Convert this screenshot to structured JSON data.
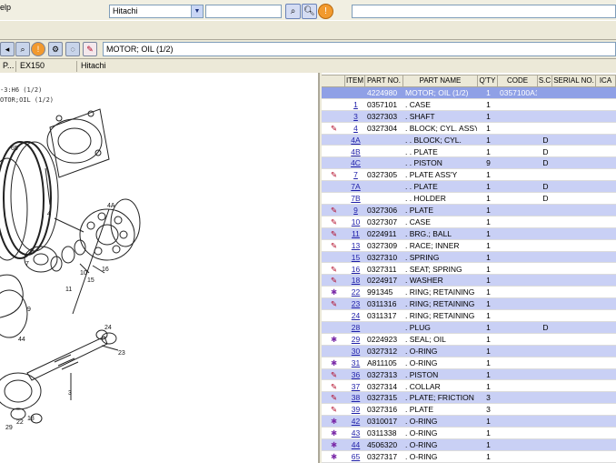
{
  "menubar": {
    "help_label": "elp"
  },
  "toolbar": {
    "manufacturer_value": "Hitachi",
    "search_value": ""
  },
  "title_box": "MOTOR; OIL (1/2)",
  "infobar": {
    "col1": "P...",
    "col2": "EX150",
    "col3": "Hitachi"
  },
  "drawing": {
    "label1": "-3:H6 (1/2)",
    "label2": "OTOR;OIL (1/2)",
    "callouts": [
      "65",
      "4",
      "3",
      "7",
      "4",
      "4A",
      "9",
      "10",
      "15",
      "16",
      "11",
      "13",
      "12",
      "8",
      "5",
      "44",
      "3",
      "24",
      "23",
      "22",
      "21",
      "29",
      "11",
      "18",
      "1"
    ]
  },
  "table": {
    "columns": [
      "ITEM",
      "PART NO.",
      "PART NAME",
      "Q'TY",
      "CODE",
      "S.C",
      "SERIAL NO.",
      "ICA"
    ],
    "rows": [
      {
        "icon": "",
        "item": "",
        "part": "4224980",
        "name": "MOTOR; OIL (1/2)",
        "qty": "1",
        "code": "0357100A1",
        "sc": "",
        "sel": true
      },
      {
        "icon": "",
        "item": "1",
        "part": "0357101",
        "name": ". CASE",
        "qty": "1",
        "code": "",
        "sc": ""
      },
      {
        "icon": "",
        "item": "3",
        "part": "0327303",
        "name": ". SHAFT",
        "qty": "1",
        "code": "",
        "sc": ""
      },
      {
        "icon": "note",
        "item": "4",
        "part": "0327304",
        "name": ". BLOCK; CYL. ASSY",
        "qty": "1",
        "code": "",
        "sc": ""
      },
      {
        "icon": "",
        "item": "4A",
        "part": "",
        "name": ". . BLOCK; CYL.",
        "qty": "1",
        "code": "",
        "sc": "D"
      },
      {
        "icon": "",
        "item": "4B",
        "part": "",
        "name": ". . PLATE",
        "qty": "1",
        "code": "",
        "sc": "D"
      },
      {
        "icon": "",
        "item": "4C",
        "part": "",
        "name": ". . PISTON",
        "qty": "9",
        "code": "",
        "sc": "D"
      },
      {
        "icon": "note",
        "item": "7",
        "part": "0327305",
        "name": ". PLATE ASS'Y",
        "qty": "1",
        "code": "",
        "sc": ""
      },
      {
        "icon": "",
        "item": "7A",
        "part": "",
        "name": ". . PLATE",
        "qty": "1",
        "code": "",
        "sc": "D"
      },
      {
        "icon": "",
        "item": "7B",
        "part": "",
        "name": ". . HOLDER",
        "qty": "1",
        "code": "",
        "sc": "D"
      },
      {
        "icon": "note",
        "item": "9",
        "part": "0327306",
        "name": ". PLATE",
        "qty": "1",
        "code": "",
        "sc": ""
      },
      {
        "icon": "note",
        "item": "10",
        "part": "0327307",
        "name": ". CASE",
        "qty": "1",
        "code": "",
        "sc": ""
      },
      {
        "icon": "note",
        "item": "11",
        "part": "0224911",
        "name": ". BRG.; BALL",
        "qty": "1",
        "code": "",
        "sc": ""
      },
      {
        "icon": "note",
        "item": "13",
        "part": "0327309",
        "name": ". RACE; INNER",
        "qty": "1",
        "code": "",
        "sc": ""
      },
      {
        "icon": "",
        "item": "15",
        "part": "0327310",
        "name": ". SPRING",
        "qty": "1",
        "code": "",
        "sc": ""
      },
      {
        "icon": "note",
        "item": "16",
        "part": "0327311",
        "name": ". SEAT; SPRING",
        "qty": "1",
        "code": "",
        "sc": ""
      },
      {
        "icon": "note",
        "item": "18",
        "part": "0224917",
        "name": ". WASHER",
        "qty": "1",
        "code": "",
        "sc": ""
      },
      {
        "icon": "gear",
        "item": "22",
        "part": "991345",
        "name": ". RING; RETAINING",
        "qty": "1",
        "code": "",
        "sc": ""
      },
      {
        "icon": "note",
        "item": "23",
        "part": "0311316",
        "name": ". RING; RETAINING",
        "qty": "1",
        "code": "",
        "sc": ""
      },
      {
        "icon": "",
        "item": "24",
        "part": "0311317",
        "name": ". RING; RETAINING",
        "qty": "1",
        "code": "",
        "sc": ""
      },
      {
        "icon": "",
        "item": "28",
        "part": "",
        "name": ". PLUG",
        "qty": "1",
        "code": "",
        "sc": "D"
      },
      {
        "icon": "gear",
        "item": "29",
        "part": "0224923",
        "name": ". SEAL; OIL",
        "qty": "1",
        "code": "",
        "sc": ""
      },
      {
        "icon": "",
        "item": "30",
        "part": "0327312",
        "name": ". O-RING",
        "qty": "1",
        "code": "",
        "sc": ""
      },
      {
        "icon": "gear",
        "item": "31",
        "part": "A811105",
        "name": ". O-RING",
        "qty": "1",
        "code": "",
        "sc": ""
      },
      {
        "icon": "note",
        "item": "36",
        "part": "0327313",
        "name": ". PISTON",
        "qty": "1",
        "code": "",
        "sc": ""
      },
      {
        "icon": "note",
        "item": "37",
        "part": "0327314",
        "name": ". COLLAR",
        "qty": "1",
        "code": "",
        "sc": ""
      },
      {
        "icon": "note",
        "item": "38",
        "part": "0327315",
        "name": ". PLATE; FRICTION",
        "qty": "3",
        "code": "",
        "sc": ""
      },
      {
        "icon": "note",
        "item": "39",
        "part": "0327316",
        "name": ". PLATE",
        "qty": "3",
        "code": "",
        "sc": ""
      },
      {
        "icon": "gear",
        "item": "42",
        "part": "0310017",
        "name": ". O-RING",
        "qty": "1",
        "code": "",
        "sc": ""
      },
      {
        "icon": "gear",
        "item": "43",
        "part": "0311338",
        "name": ". O-RING",
        "qty": "1",
        "code": "",
        "sc": ""
      },
      {
        "icon": "gear",
        "item": "44",
        "part": "4506320",
        "name": ". O-RING",
        "qty": "1",
        "code": "",
        "sc": ""
      },
      {
        "icon": "gear",
        "item": "65",
        "part": "0327317",
        "name": ". O-RING",
        "qty": "1",
        "code": "",
        "sc": ""
      }
    ]
  }
}
